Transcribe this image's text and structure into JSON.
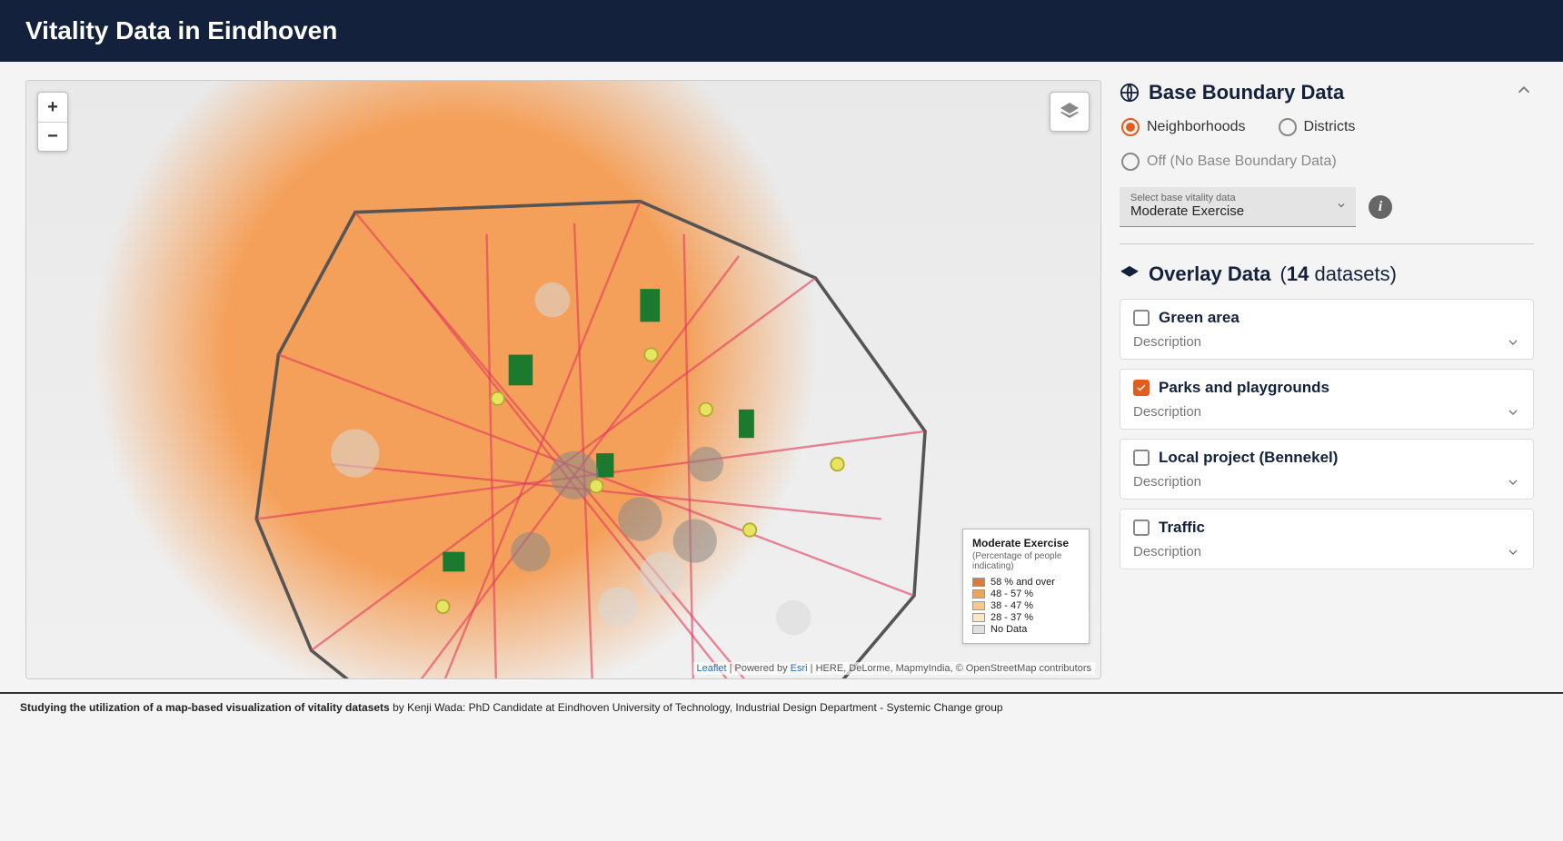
{
  "header": {
    "title": "Vitality Data in Eindhoven"
  },
  "map": {
    "zoom_in": "+",
    "zoom_out": "−",
    "attribution_leaflet": "Leaflet",
    "attribution_powered": " | Powered by ",
    "attribution_esri": "Esri",
    "attribution_rest": " | HERE, DeLorme, MapmyIndia, © OpenStreetMap contributors"
  },
  "legend": {
    "title": "Moderate Exercise",
    "subtitle": "(Percentage of people indicating)",
    "items": [
      {
        "label": "58 % and over",
        "color": "#db7a3a"
      },
      {
        "label": "48 - 57 %",
        "color": "#f2a35b"
      },
      {
        "label": "38 - 47 %",
        "color": "#f7c98e"
      },
      {
        "label": "28 - 37 %",
        "color": "#fbe7c7"
      },
      {
        "label": "No Data",
        "color": "#e0e0e0"
      }
    ]
  },
  "boundary": {
    "section_title": "Base Boundary Data",
    "options": [
      {
        "label": "Neighborhoods",
        "selected": true,
        "muted": false
      },
      {
        "label": "Districts",
        "selected": false,
        "muted": false
      },
      {
        "label": "Off (No Base Boundary Data)",
        "selected": false,
        "muted": true
      }
    ],
    "select_label": "Select base vitality data",
    "select_value": "Moderate Exercise"
  },
  "overlay": {
    "section_title": "Overlay Data",
    "count": "14",
    "count_suffix": " datasets)",
    "count_prefix": "(",
    "desc_label": "Description",
    "items": [
      {
        "label": "Green area",
        "checked": false
      },
      {
        "label": "Parks and playgrounds",
        "checked": true
      },
      {
        "label": "Local project (Bennekel)",
        "checked": false
      },
      {
        "label": "Traffic",
        "checked": false
      }
    ]
  },
  "footer": {
    "bold": "Studying the utilization of a map-based visualization of vitality datasets",
    "rest": " by Kenji Wada: PhD Candidate at Eindhoven University of Technology, Industrial Design Department - Systemic Change group"
  }
}
